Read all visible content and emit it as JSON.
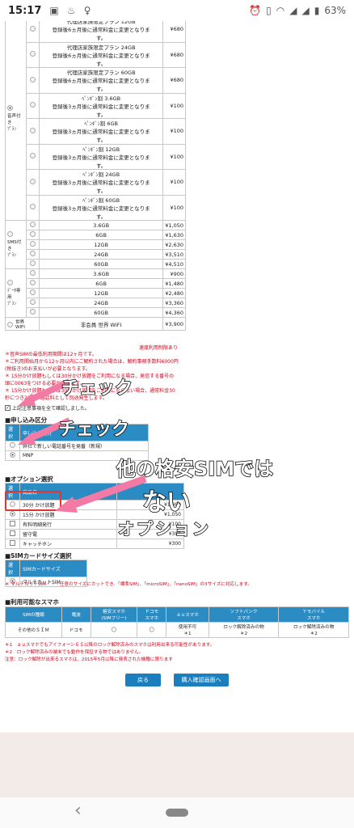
{
  "status_bar": {
    "time": "15:17",
    "battery": "63%"
  },
  "plan_table": {
    "voice_group_label": "音声付き\nﾌﾟﾗﾝ",
    "sms_group_label": "SMS付き\nﾌﾟﾗﾝ",
    "data_group_label": "ﾃﾞｰﾀ専用\nﾌﾟﾗﾝ",
    "wifi_label": "世界\nWIFI",
    "voice_rows": [
      {
        "name": "代理店家族限定プラン 12GB\n登録後6ヵ月後に通常料金に変更となりま\nす。",
        "price": "¥680"
      },
      {
        "name": "代理店家族限定プラン 24GB\n登録後6ヵ月後に通常料金に変更となりま\nす。",
        "price": "¥680"
      },
      {
        "name": "代理店家族限定プラン 60GB\n登録後6ヵ月後に通常料金に変更となりま\nす。",
        "price": "¥680"
      },
      {
        "name": "ﾍﾟﾝｷﾞﾝ割 3.6GB\n登録後3ヵ月後に通常料金に変更となりま\nす。",
        "price": "¥100"
      },
      {
        "name": "ﾍﾟﾝｷﾞﾝ割 6GB\n登録後3ヵ月後に通常料金に変更となりま\nす。",
        "price": "¥100"
      },
      {
        "name": "ﾍﾟﾝｷﾞﾝ割 12GB\n登録後3ヵ月後に通常料金に変更となりま\nす。",
        "price": "¥100"
      },
      {
        "name": "ﾍﾟﾝｷﾞﾝ割 24GB\n登録後3ヵ月後に通常料金に変更となりま\nす。",
        "price": "¥100"
      },
      {
        "name": "ﾍﾟﾝｷﾞﾝ割 60GB\n登録後3ヵ月後に通常料金に変更となりま\nす。",
        "price": "¥100"
      }
    ],
    "sms_rows": [
      {
        "name": "3.6GB",
        "price": "¥1,050"
      },
      {
        "name": "6GB",
        "price": "¥1,630"
      },
      {
        "name": "12GB",
        "price": "¥2,630"
      },
      {
        "name": "24GB",
        "price": "¥3,510"
      },
      {
        "name": "60GB",
        "price": "¥4,510"
      }
    ],
    "data_rows": [
      {
        "name": "3.6GB",
        "price": "¥900"
      },
      {
        "name": "6GB",
        "price": "¥1,480"
      },
      {
        "name": "12GB",
        "price": "¥2,480"
      },
      {
        "name": "24GB",
        "price": "¥3,360"
      },
      {
        "name": "60GB",
        "price": "¥4,360"
      }
    ],
    "wifi_row": {
      "name": "非会員 世界 WIFI",
      "price": "¥3,900"
    },
    "footnote_right": "速度利用制限あり"
  },
  "notes": [
    "＊音声SIMの最低利用期間は12ヶ月です。",
    "＊ご利用開始月から12ヶ月以内にご解約された場合は、解約事務手数料6000円",
    "(税抜き)のお支払いが必要となります。",
    "＊ 15分かけ放題もしくは30分かけ放題をご利用になる場合、発信する番号の",
    "頭に0063をつける必要があります。",
    "＊ 15分かけ放題もしくは30分かけ放題をご利用にならない場合、通常料金30",
    "秒につき20円が通話料として別途発生します。"
  ],
  "agree_text": "上記注意事項を全て確認しました。",
  "application": {
    "heading": "■申し込み区分",
    "col_select": "選択",
    "col_kind": "申し込み区分",
    "rows": [
      "弊社で新しい電話番号を発番（新規）",
      "MNP"
    ]
  },
  "options": {
    "heading": "■オプション選択",
    "col_select": "選択",
    "col_name": "商品名",
    "rows": [
      {
        "name": "30分 かけ放題",
        "price": "¥1,980"
      },
      {
        "name": "15分 かけ放題",
        "price": "¥1,050"
      },
      {
        "name": "有料明細発行",
        "price": "¥100"
      },
      {
        "name": "留守電",
        "price": "¥300"
      },
      {
        "name": "キャッチホン",
        "price": "¥300"
      }
    ]
  },
  "sim_size": {
    "heading": "■SIMカードサイズ選択",
    "col_select": "選択",
    "col_size": "SIMカードサイズ",
    "row": "マルチカットSIM",
    "note": "＊ マルチカットSIM・・・任意のサイズにカットでき、「標準SIM」、「microSIM」、「nanoSIM」の3サイズに対応します。"
  },
  "phones": {
    "heading": "■利用可能なスマホ",
    "headers": [
      "SIMの種類",
      "電波",
      "格安スマホ\n(SIMフリー)",
      "ドコモ\nスマホ",
      "ａｕスマホ",
      "ソフトバンク\nスマホ",
      "Ｙモバイル\nスマホ"
    ],
    "row": [
      "その他のＳＩＭ",
      "ドコモ",
      "◯",
      "◯",
      "使用不可\n＊1",
      "ロック解除済みの物\n＊2",
      "ロック解除済みの物\n＊2"
    ],
    "notes": [
      "＊1　ａｕスマホでもアイフォーン６Ｓ以降のロック解除済みのスマホは利用出来る可能性があります。",
      "＊2　ロック解除済みの端末でも動作を保証する物ではありません。",
      "注意：ロック解除が出来るスマホは、2015年5月以降に発表された機種に限ります"
    ]
  },
  "buttons": {
    "back": "戻る",
    "confirm": "購入確認画面へ"
  },
  "overlay": {
    "check1": "チェック",
    "check2": "チェック",
    "not_other": "他の格安SIMでは",
    "nai": "ない",
    "option": "オプション"
  }
}
